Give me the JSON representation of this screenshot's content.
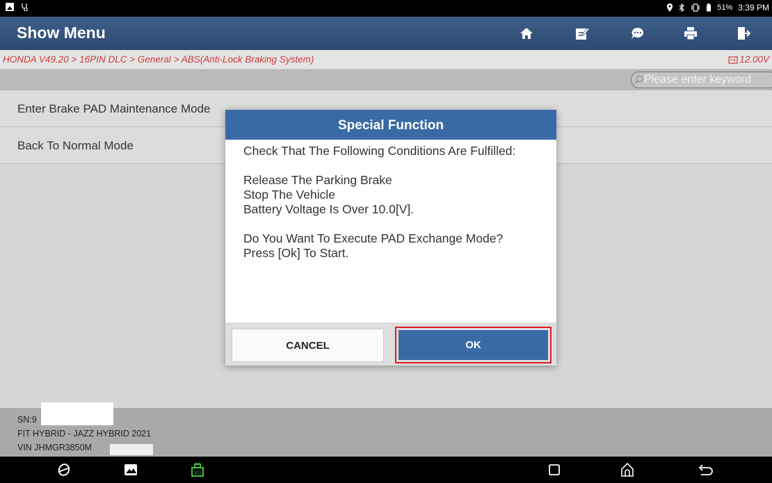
{
  "status_bar": {
    "battery_percent": "51%",
    "time": "3:39 PM",
    "icons": [
      "image-icon",
      "stethoscope-icon",
      "location-icon",
      "bluetooth-icon",
      "vibrate-icon",
      "battery-icon"
    ]
  },
  "header": {
    "title": "Show Menu",
    "buttons": [
      "home-icon",
      "edit-report-icon",
      "feedback-icon",
      "print-icon",
      "exit-icon"
    ]
  },
  "breadcrumb": {
    "path": "HONDA V49.20 > 16PIN DLC > General > ABS(Anti-Lock Braking System)",
    "voltage": "12.00V"
  },
  "search": {
    "placeholder": "Please enter keyword"
  },
  "menu": {
    "items": [
      {
        "label": "Enter Brake PAD Maintenance Mode"
      },
      {
        "label": "Back To Normal Mode"
      }
    ]
  },
  "footer": {
    "sn": "SN:9",
    "model": "FIT HYBRID - JAZZ HYBRID 2021",
    "vin": "VIN JHMGR3850M"
  },
  "dialog": {
    "title": "Special Function",
    "lines": [
      "Check That The Following Conditions Are Fulfilled:",
      "Release The Parking Brake",
      "Stop The Vehicle",
      "Battery Voltage Is Over 10.0[V].",
      "Do You Want To Execute PAD Exchange Mode?",
      "Press [Ok] To Start."
    ],
    "cancel_label": "CANCEL",
    "ok_label": "OK"
  },
  "colors": {
    "header_blue": "#2c4a73",
    "dialog_blue": "#3a6aa6",
    "breadcrumb_red": "#d23a3a",
    "highlight_red": "#e01b24",
    "vci_green": "#3fbf3f"
  },
  "navigation": {
    "icons": [
      "browser-icon",
      "gallery-icon",
      "vci-icon",
      "recents-icon",
      "home-nav-icon",
      "back-icon"
    ]
  }
}
